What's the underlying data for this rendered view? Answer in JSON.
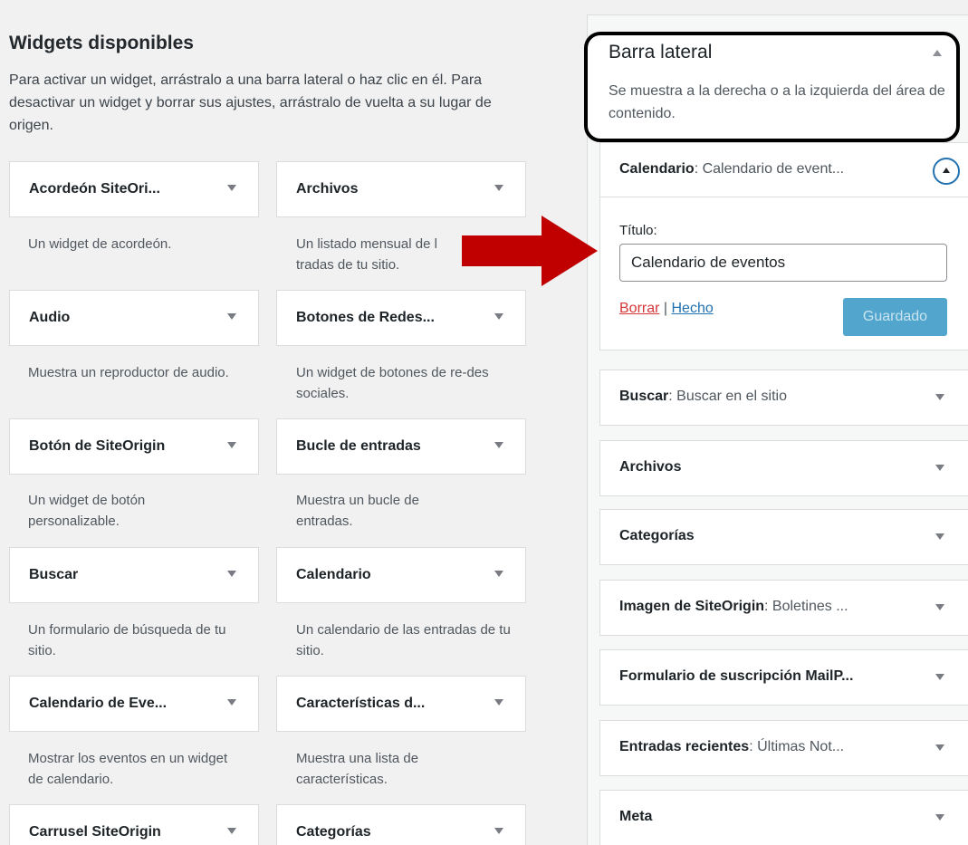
{
  "available": {
    "title": "Widgets disponibles",
    "description": "Para activar un widget, arrástralo a una barra lateral o haz clic en él. Para desactivar un widget y borrar sus ajustes, arrástralo de vuelta a su lugar de origen.",
    "widgets": [
      {
        "title": "Acordeón SiteOri...",
        "desc": "Un widget de acordeón."
      },
      {
        "title": "Archivos",
        "desc": "Un listado mensual de l tradas de tu sitio."
      },
      {
        "title": "Audio",
        "desc": "Muestra un reproductor de audio."
      },
      {
        "title": "Botones de Redes...",
        "desc": "Un widget de botones de re-des sociales."
      },
      {
        "title": "Botón de SiteOrigin",
        "desc": "Un widget de botón personalizable."
      },
      {
        "title": "Bucle de entradas",
        "desc": "Muestra un bucle de entradas."
      },
      {
        "title": "Buscar",
        "desc": "Un formulario de búsqueda de tu sitio."
      },
      {
        "title": "Calendario",
        "desc": "Un calendario de las entradas de tu sitio."
      },
      {
        "title": "Calendario de Eve...",
        "desc": "Mostrar los eventos en un widget de calendario."
      },
      {
        "title": "Características d...",
        "desc": "Muestra una lista de características."
      },
      {
        "title": "Carrusel SiteOrigin",
        "desc": ""
      },
      {
        "title": "Categorías",
        "desc": ""
      }
    ]
  },
  "sidebar": {
    "title": "Barra lateral",
    "description": "Se muestra a la derecha o a la izquierda del área de contenido.",
    "open_widget": {
      "name": "Calendario",
      "subtitle": ": Calendario de event...",
      "field_label": "Título:",
      "field_value": "Calendario de eventos",
      "delete_label": "Borrar",
      "separator": " | ",
      "done_label": "Hecho",
      "save_label": "Guardado"
    },
    "widgets": [
      {
        "name": "Buscar",
        "subtitle": ": Buscar en el sitio"
      },
      {
        "name": "Archivos",
        "subtitle": ""
      },
      {
        "name": "Categorías",
        "subtitle": ""
      },
      {
        "name": "Imagen de SiteOrigin",
        "subtitle": ": Boletines ..."
      },
      {
        "name": "Formulario de suscripción MailP...",
        "subtitle": ""
      },
      {
        "name": "Entradas recientes",
        "subtitle": ": Últimas Not..."
      },
      {
        "name": "Meta",
        "subtitle": ""
      }
    ]
  },
  "colors": {
    "arrow": "#c00000",
    "highlight_border": "#000000",
    "link": "#2271b1",
    "delete": "#d63638",
    "save_button": "#52a6cd"
  }
}
